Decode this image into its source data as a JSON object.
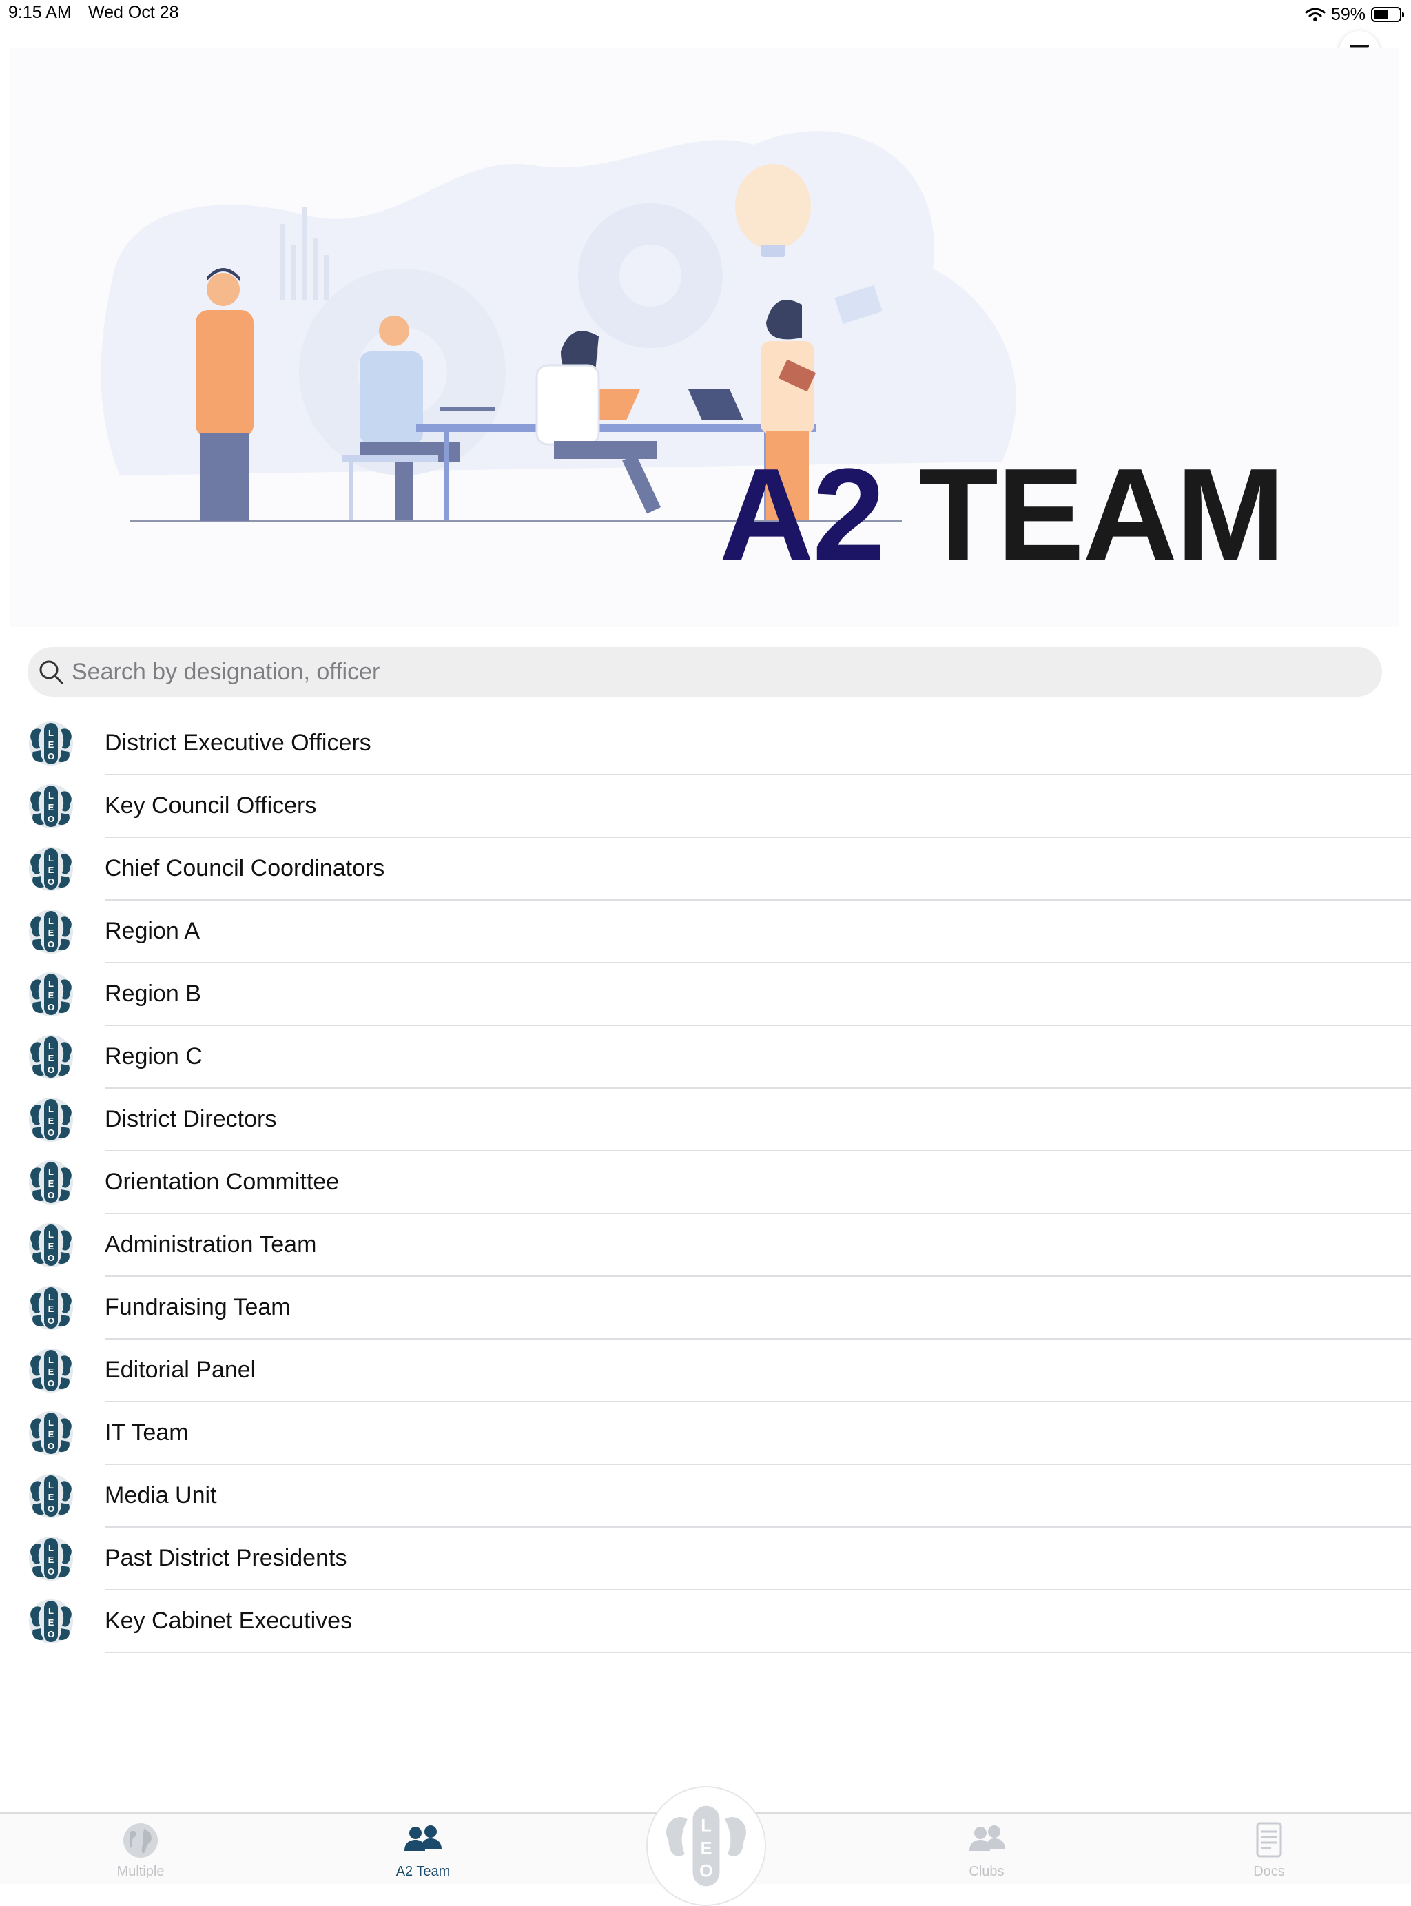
{
  "status_bar": {
    "time": "9:15 AM",
    "date": "Wed Oct 28",
    "battery_percent": "59%",
    "battery_level": 0.59
  },
  "header": {
    "menu_icon": "hamburger-menu-icon"
  },
  "hero": {
    "title_a2": "A2",
    "title_team": "TEAM",
    "colors": {
      "a2": "#1c1566",
      "team": "#1a1a1a"
    }
  },
  "search": {
    "placeholder": "Search by designation, officer",
    "value": ""
  },
  "list": {
    "icon": "leo-logo-icon",
    "items": [
      {
        "label": "District Executive Officers"
      },
      {
        "label": "Key Council Officers"
      },
      {
        "label": "Chief Council Coordinators"
      },
      {
        "label": "Region A"
      },
      {
        "label": "Region B"
      },
      {
        "label": "Region C"
      },
      {
        "label": "District Directors"
      },
      {
        "label": "Orientation Committee"
      },
      {
        "label": "Administration Team"
      },
      {
        "label": "Fundraising Team"
      },
      {
        "label": "Editorial Panel"
      },
      {
        "label": "IT Team"
      },
      {
        "label": "Media Unit"
      },
      {
        "label": "Past District Presidents"
      },
      {
        "label": "Key Cabinet Executives"
      }
    ]
  },
  "tab_bar": {
    "tabs": [
      {
        "label": "Multiple",
        "icon": "globe-icon",
        "active": false
      },
      {
        "label": "A2 Team",
        "icon": "team-icon",
        "active": true
      },
      {
        "label": "",
        "icon": "leo-logo-icon",
        "active": false
      },
      {
        "label": "Clubs",
        "icon": "users-icon",
        "active": false
      },
      {
        "label": "Docs",
        "icon": "document-icon",
        "active": false
      }
    ],
    "colors": {
      "active": "#1c4a6b",
      "inactive": "#c3c3c7"
    }
  }
}
